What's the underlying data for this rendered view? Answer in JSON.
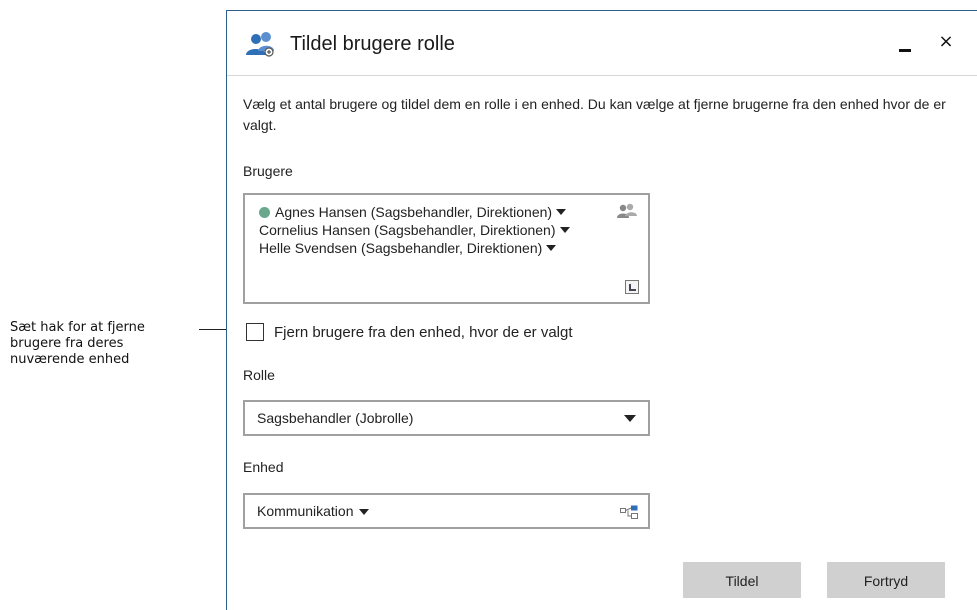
{
  "annotation": {
    "text_line1": "Sæt hak for at fjerne",
    "text_line2": "brugere fra deres",
    "text_line3": "nuværende enhed"
  },
  "dialog": {
    "title": "Tildel brugere rolle",
    "title_icon": "users-icon",
    "minimize_icon": "minimize-icon",
    "close_label": "×",
    "description": "Vælg et antal brugere og tildel dem en rolle i en enhed. Du kan vælge at fjerne brugerne fra den enhed hvor de er valgt.",
    "users": {
      "label": "Brugere",
      "items": [
        "Agnes Hansen (Sagsbehandler, Direktionen)",
        "Cornelius Hansen (Sagsbehandler, Direktionen)",
        "Helle Svendsen (Sagsbehandler, Direktionen)"
      ],
      "first_status_color": "#6aa88e",
      "add_icon": "add-users-icon",
      "expand_icon": "expand-icon"
    },
    "remove_checkbox": {
      "label": "Fjern brugere fra den enhed, hvor de er valgt",
      "checked": false
    },
    "role": {
      "label": "Rolle",
      "selected": "Sagsbehandler (Jobrolle)"
    },
    "unit": {
      "label": "Enhed",
      "selected": "Kommunikation",
      "tree_icon": "org-tree-icon"
    },
    "buttons": {
      "assign": "Tildel",
      "cancel": "Fortryd"
    },
    "colors": {
      "border_accent": "#2f5f8f",
      "button_bg": "#d0d0d0",
      "icon_blue": "#2e6fb8"
    }
  }
}
